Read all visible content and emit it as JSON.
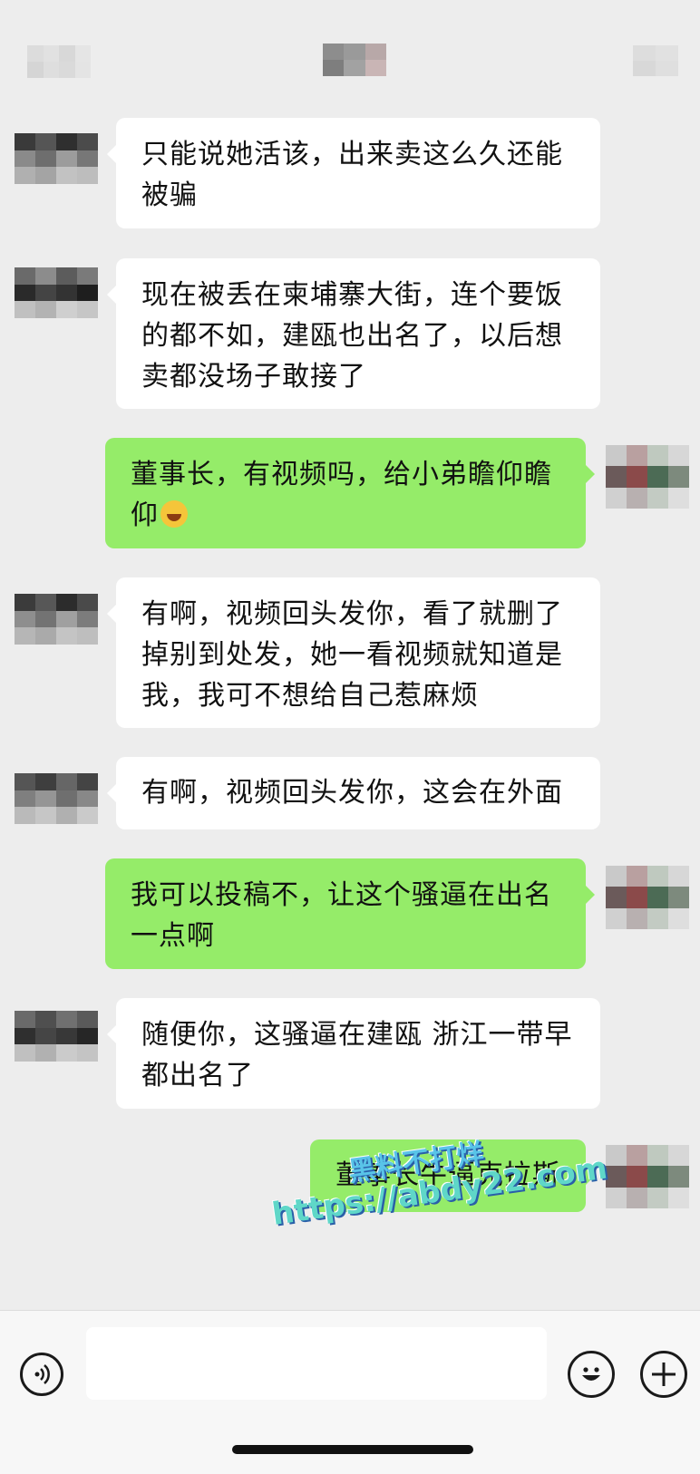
{
  "messages": [
    {
      "side": "in",
      "text": "只能说她活该，出来卖这么久还能被骗"
    },
    {
      "side": "in",
      "text": "现在被丢在柬埔寨大街，连个要饭的都不如，建瓯也出名了，以后想卖都没场子敢接了"
    },
    {
      "side": "out",
      "text": "董事长，有视频吗，给小弟瞻仰瞻仰",
      "emoji": "rolling-on-floor-laughing"
    },
    {
      "side": "in",
      "text": "有啊，视频回头发你，看了就删了掉别到处发，她一看视频就知道是我，我可不想给自己惹麻烦"
    },
    {
      "side": "in",
      "text": "有啊，视频回头发你，这会在外面"
    },
    {
      "side": "out",
      "text": "我可以投稿不，让这个骚逼在出名一点啊"
    },
    {
      "side": "in",
      "text": "随便你，这骚逼在建瓯 浙江一带早都出名了"
    },
    {
      "side": "out",
      "text": "董事长牛逼克拉斯"
    }
  ],
  "watermark": {
    "line1": "黑料不打烊",
    "line2": "https://abdy22.com"
  },
  "input": {
    "placeholder": ""
  },
  "icons": {
    "voice": "voice-icon",
    "emoji": "emoji-face-icon",
    "more": "plus-icon"
  },
  "colors": {
    "background": "#ededed",
    "incoming_bubble": "#ffffff",
    "outgoing_bubble": "#95ec69"
  }
}
